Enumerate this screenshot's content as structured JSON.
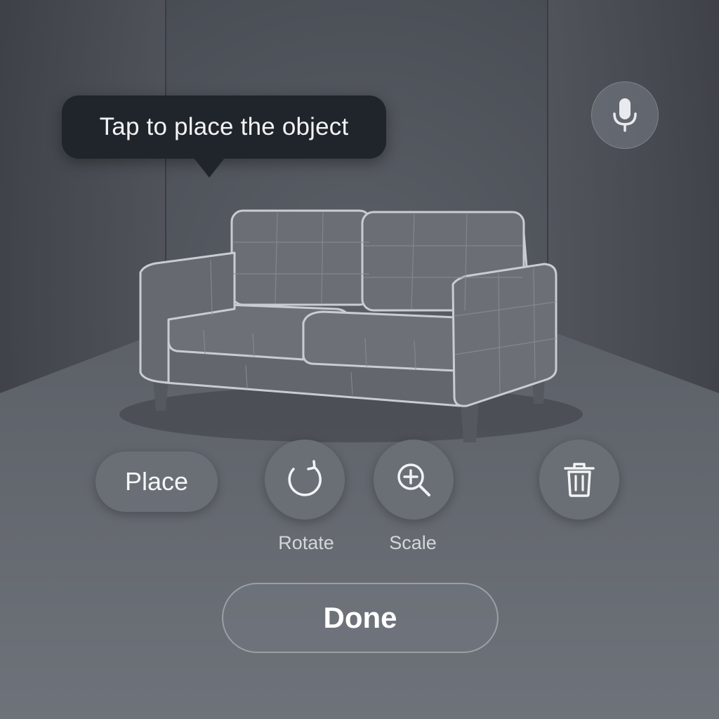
{
  "tooltip": {
    "text": "Tap to place the object"
  },
  "toolbar": {
    "mic_icon": "microphone-icon",
    "place_label": "Place",
    "rotate_icon": "rotate-icon",
    "rotate_label": "Rotate",
    "scale_icon": "zoom-in-icon",
    "scale_label": "Scale",
    "delete_icon": "trash-icon"
  },
  "done": {
    "label": "Done"
  },
  "colors": {
    "background": "#4b4f55",
    "tooltip_bg": "#20252b",
    "button_bg": "#6a6f76",
    "sofa": "#6b6f75",
    "sofa_outline": "#c9ccd1"
  }
}
